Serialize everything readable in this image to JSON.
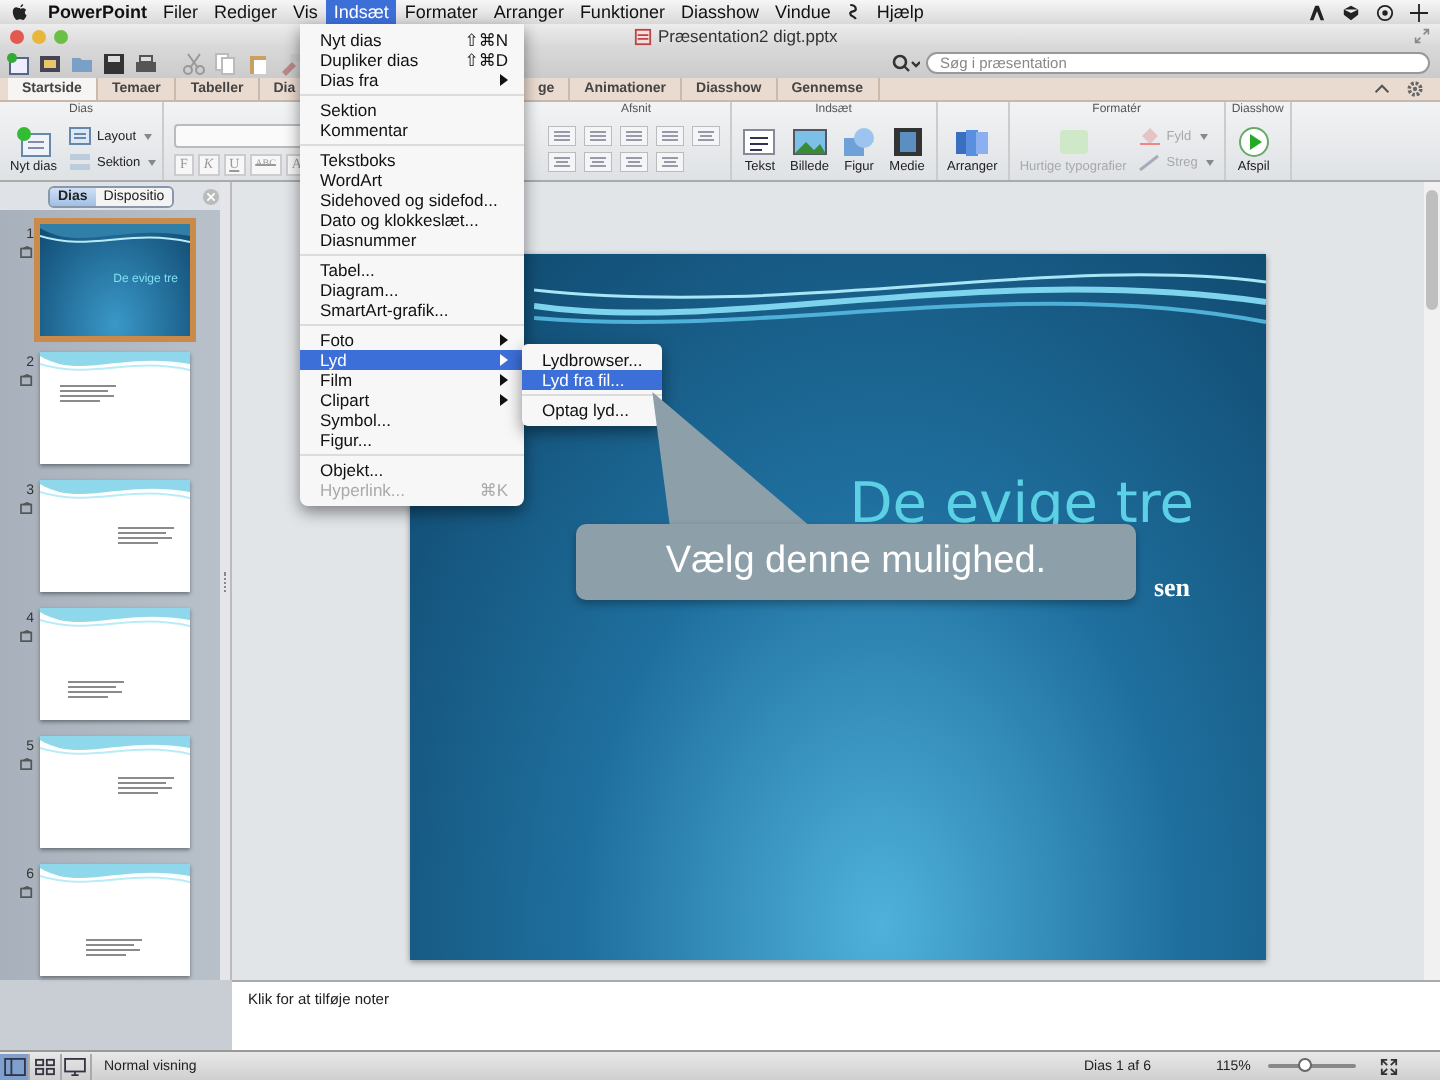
{
  "menu_bar": {
    "items": [
      {
        "label": "PowerPoint",
        "kind": "app",
        "selected": false
      },
      {
        "label": "Filer",
        "kind": "menu",
        "selected": false
      },
      {
        "label": "Rediger",
        "kind": "menu",
        "selected": false
      },
      {
        "label": "Vis",
        "kind": "menu",
        "selected": false
      },
      {
        "label": "Indsæt",
        "kind": "menu",
        "selected": true
      },
      {
        "label": "Formater",
        "kind": "menu",
        "selected": false
      },
      {
        "label": "Arranger",
        "kind": "menu",
        "selected": false
      },
      {
        "label": "Funktioner",
        "kind": "menu",
        "selected": false
      },
      {
        "label": "Diasshow",
        "kind": "menu",
        "selected": false
      },
      {
        "label": "Vindue",
        "kind": "menu",
        "selected": false
      },
      {
        "kind": "script",
        "selected": false
      },
      {
        "label": "Hjælp",
        "kind": "menu",
        "selected": false
      }
    ]
  },
  "window": {
    "title": "Præsentation2 digt.pptx"
  },
  "search": {
    "placeholder": "Søg i præsentation"
  },
  "ribbon": {
    "tab_groups": [
      {
        "tabs": [
          {
            "label": "Startside",
            "selected": true
          },
          {
            "label": "Temaer",
            "selected": false
          },
          {
            "label": "Tabeller",
            "selected": false
          },
          {
            "label": "Dia",
            "selected": false
          }
        ]
      },
      {
        "tabs": [
          {
            "label": "ge",
            "selected": false
          },
          {
            "label": "Animationer",
            "selected": false
          },
          {
            "label": "Diasshow",
            "selected": false
          },
          {
            "label": "Gennemse",
            "selected": false
          }
        ]
      }
    ],
    "groups": [
      {
        "kind": "buttons",
        "title": "Dias",
        "buttons": [
          {
            "label": "Nyt dias",
            "kind": "newslide",
            "disabled": false
          },
          {
            "label": "Layout",
            "kind": "layout",
            "disabled": false
          },
          {
            "label": "Sektion",
            "kind": "section",
            "disabled": false
          }
        ]
      },
      {
        "kind": "font",
        "format_buttons": [
          "F",
          "K",
          "U",
          "ABC",
          "A"
        ]
      },
      {
        "kind": "paragraph",
        "title": "Afsnit"
      },
      {
        "kind": "buttons",
        "title": "Indsæt",
        "buttons": [
          {
            "label": "Tekst",
            "kind": "text",
            "disabled": false
          },
          {
            "label": "Billede",
            "kind": "picture",
            "disabled": false
          },
          {
            "label": "Figur",
            "kind": "shape",
            "disabled": false
          },
          {
            "label": "Medie",
            "kind": "media",
            "disabled": false
          }
        ]
      },
      {
        "kind": "buttons",
        "buttons": [
          {
            "label": "Arranger",
            "kind": "arrange",
            "disabled": false
          }
        ]
      },
      {
        "kind": "buttons",
        "title": "Formatér",
        "buttons": [
          {
            "label": "Hurtige typografier",
            "kind": "styles",
            "disabled": true
          },
          {
            "label": "Fyld",
            "kind": "fill",
            "disabled": true
          },
          {
            "label": "Streg",
            "kind": "line",
            "disabled": true
          }
        ]
      },
      {
        "kind": "buttons",
        "title": "Diasshow",
        "buttons": [
          {
            "label": "Afspil",
            "kind": "play",
            "disabled": false
          }
        ]
      }
    ]
  },
  "insert_menu": {
    "items": [
      {
        "kind": "item",
        "label": "Nyt dias",
        "shortcut": "⇧⌘N",
        "submenu": false,
        "selected": false,
        "disabled": false
      },
      {
        "kind": "item",
        "label": "Dupliker dias",
        "shortcut": "⇧⌘D",
        "submenu": false,
        "selected": false,
        "disabled": false
      },
      {
        "kind": "item",
        "label": "Dias fra",
        "submenu": true,
        "selected": false,
        "disabled": false
      },
      {
        "kind": "separator"
      },
      {
        "kind": "item",
        "label": "Sektion",
        "submenu": false,
        "selected": false,
        "disabled": false
      },
      {
        "kind": "item",
        "label": "Kommentar",
        "submenu": false,
        "selected": false,
        "disabled": false
      },
      {
        "kind": "separator"
      },
      {
        "kind": "item",
        "label": "Tekstboks",
        "submenu": false,
        "selected": false,
        "disabled": false
      },
      {
        "kind": "item",
        "label": "WordArt",
        "submenu": false,
        "selected": false,
        "disabled": false
      },
      {
        "kind": "item",
        "label": "Sidehoved og sidefod...",
        "submenu": false,
        "selected": false,
        "disabled": false
      },
      {
        "kind": "item",
        "label": "Dato og klokkeslæt...",
        "submenu": false,
        "selected": false,
        "disabled": false
      },
      {
        "kind": "item",
        "label": "Diasnummer",
        "submenu": false,
        "selected": false,
        "disabled": false
      },
      {
        "kind": "separator"
      },
      {
        "kind": "item",
        "label": "Tabel...",
        "submenu": false,
        "selected": false,
        "disabled": false
      },
      {
        "kind": "item",
        "label": "Diagram...",
        "submenu": false,
        "selected": false,
        "disabled": false
      },
      {
        "kind": "item",
        "label": "SmartArt-grafik...",
        "submenu": false,
        "selected": false,
        "disabled": false
      },
      {
        "kind": "separator"
      },
      {
        "kind": "item",
        "label": "Foto",
        "submenu": true,
        "selected": false,
        "disabled": false
      },
      {
        "kind": "item",
        "label": "Lyd",
        "submenu": true,
        "selected": true,
        "disabled": false
      },
      {
        "kind": "item",
        "label": "Film",
        "submenu": true,
        "selected": false,
        "disabled": false
      },
      {
        "kind": "item",
        "label": "Clipart",
        "submenu": true,
        "selected": false,
        "disabled": false
      },
      {
        "kind": "item",
        "label": "Symbol...",
        "submenu": false,
        "selected": false,
        "disabled": false
      },
      {
        "kind": "item",
        "label": "Figur...",
        "submenu": false,
        "selected": false,
        "disabled": false
      },
      {
        "kind": "separator"
      },
      {
        "kind": "item",
        "label": "Objekt...",
        "submenu": false,
        "selected": false,
        "disabled": false
      },
      {
        "kind": "item",
        "label": "Hyperlink...",
        "shortcut": "⌘K",
        "submenu": false,
        "selected": false,
        "disabled": true
      }
    ]
  },
  "sound_submenu": {
    "items": [
      {
        "kind": "item",
        "label": "Lydbrowser...",
        "selected": false
      },
      {
        "kind": "item",
        "label": "Lyd fra fil...",
        "selected": true
      },
      {
        "kind": "separator"
      },
      {
        "kind": "item",
        "label": "Optag lyd...",
        "selected": false
      }
    ]
  },
  "slide_panel": {
    "tabs": [
      {
        "label": "Dias",
        "selected": true
      },
      {
        "label": "Dispositio",
        "selected": false
      }
    ],
    "slides": [
      {
        "number": "1",
        "kind": "title",
        "title": "De evige tre",
        "selected": true
      },
      {
        "number": "2",
        "kind": "text",
        "selected": false
      },
      {
        "number": "3",
        "kind": "text",
        "selected": false
      },
      {
        "number": "4",
        "kind": "text",
        "selected": false
      },
      {
        "number": "5",
        "kind": "text",
        "selected": false
      },
      {
        "number": "6",
        "kind": "text",
        "selected": false
      }
    ]
  },
  "slide": {
    "title": "De evige tre",
    "subtitle": "sen"
  },
  "callout": {
    "text": "Vælg denne mulighed."
  },
  "notes": {
    "placeholder": "Klik for at tilføje noter"
  },
  "status_bar": {
    "views": [
      {
        "kind": "normal",
        "selected": true
      },
      {
        "kind": "sorter",
        "selected": false
      },
      {
        "kind": "show",
        "selected": false
      }
    ],
    "view_name": "Normal visning",
    "slide_position": "Dias 1 af 6",
    "zoom": "115%",
    "zoom_slider": {
      "level": 0.42
    }
  }
}
